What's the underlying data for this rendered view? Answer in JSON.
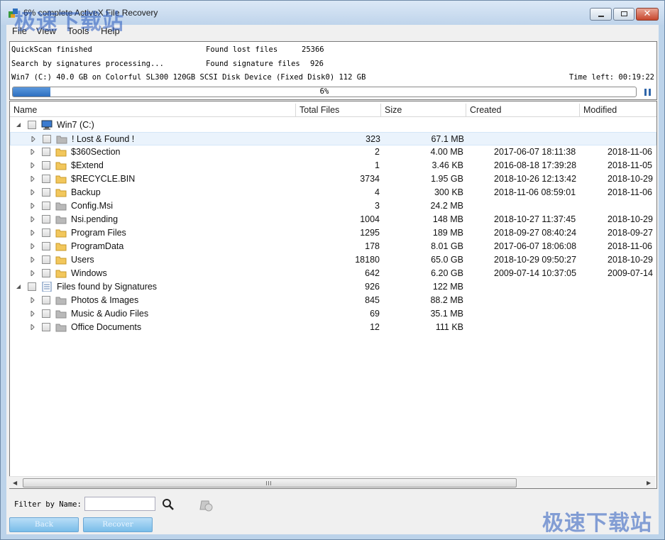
{
  "window": {
    "title": "6% complete ActiveX File Recovery",
    "controls": {
      "close_glyph": "✕"
    }
  },
  "menu": [
    "File",
    "View",
    "Tools",
    "Help"
  ],
  "watermarks": [
    "极速下载站",
    "极速下载站"
  ],
  "status": {
    "line1_left": "QuickScan finished",
    "line1_label": "Found lost files",
    "line1_value": "25366",
    "line2_left": "Search by signatures processing...",
    "line2_label": "Found signature files",
    "line2_value": "926",
    "line3_left": "Win7 (C:) 40.0 GB on Colorful SL300 120GB SCSI Disk Device (Fixed Disk0) 112 GB",
    "time_left": "Time left: 00:19:22",
    "progress_percent": 6,
    "progress_label": "6%"
  },
  "columns": [
    "Name",
    "Total Files",
    "Size",
    "Created",
    "Modified"
  ],
  "rows": [
    {
      "level": 0,
      "expanded": true,
      "icon": "drive-icon",
      "name": "Win7 (C:)",
      "files": "",
      "size": "",
      "created": "",
      "modified": ""
    },
    {
      "level": 1,
      "expanded": false,
      "icon": "gray-folder-icon",
      "name": "! Lost & Found !",
      "files": "323",
      "size": "67.1 MB",
      "created": "",
      "modified": "",
      "highlight": true
    },
    {
      "level": 1,
      "expanded": false,
      "icon": "folder-icon",
      "name": "$360Section",
      "files": "2",
      "size": "4.00 MB",
      "created": "2017-06-07 18:11:38",
      "modified": "2018-11-06"
    },
    {
      "level": 1,
      "expanded": false,
      "icon": "folder-icon",
      "name": "$Extend",
      "files": "1",
      "size": "3.46 KB",
      "created": "2016-08-18 17:39:28",
      "modified": "2018-11-05"
    },
    {
      "level": 1,
      "expanded": false,
      "icon": "folder-icon",
      "name": "$RECYCLE.BIN",
      "files": "3734",
      "size": "1.95 GB",
      "created": "2018-10-26 12:13:42",
      "modified": "2018-10-29"
    },
    {
      "level": 1,
      "expanded": false,
      "icon": "folder-icon",
      "name": "Backup",
      "files": "4",
      "size": "300 KB",
      "created": "2018-11-06 08:59:01",
      "modified": "2018-11-06"
    },
    {
      "level": 1,
      "expanded": false,
      "icon": "gray-folder-icon",
      "name": "Config.Msi",
      "files": "3",
      "size": "24.2 MB",
      "created": "",
      "modified": ""
    },
    {
      "level": 1,
      "expanded": false,
      "icon": "gray-folder-icon",
      "name": "Nsi.pending",
      "files": "1004",
      "size": "148 MB",
      "created": "2018-10-27 11:37:45",
      "modified": "2018-10-29"
    },
    {
      "level": 1,
      "expanded": false,
      "icon": "folder-icon",
      "name": "Program Files",
      "files": "1295",
      "size": "189 MB",
      "created": "2018-09-27 08:40:24",
      "modified": "2018-09-27"
    },
    {
      "level": 1,
      "expanded": false,
      "icon": "folder-icon",
      "name": "ProgramData",
      "files": "178",
      "size": "8.01 GB",
      "created": "2017-06-07 18:06:08",
      "modified": "2018-11-06"
    },
    {
      "level": 1,
      "expanded": false,
      "icon": "folder-icon",
      "name": "Users",
      "files": "18180",
      "size": "65.0 GB",
      "created": "2018-10-29 09:50:27",
      "modified": "2018-10-29"
    },
    {
      "level": 1,
      "expanded": false,
      "icon": "folder-icon",
      "name": "Windows",
      "files": "642",
      "size": "6.20 GB",
      "created": "2009-07-14 10:37:05",
      "modified": "2009-07-14"
    },
    {
      "level": 0,
      "expanded": true,
      "icon": "signature-list-icon",
      "name": "Files found by Signatures",
      "files": "926",
      "size": "122 MB",
      "created": "",
      "modified": ""
    },
    {
      "level": 1,
      "expanded": false,
      "icon": "gray-folder-icon",
      "name": "Photos & Images",
      "files": "845",
      "size": "88.2 MB",
      "created": "",
      "modified": ""
    },
    {
      "level": 1,
      "expanded": false,
      "icon": "gray-folder-icon",
      "name": "Music & Audio Files",
      "files": "69",
      "size": "35.1 MB",
      "created": "",
      "modified": ""
    },
    {
      "level": 1,
      "expanded": false,
      "icon": "gray-folder-icon",
      "name": "Office Documents",
      "files": "12",
      "size": "111 KB",
      "created": "",
      "modified": ""
    }
  ],
  "filter": {
    "label": "Filter by Name:",
    "value": ""
  },
  "buttons": {
    "back": "Back",
    "recover": "Recover"
  },
  "colors": {
    "accent": "#2d6fbf",
    "folder": "#f2c75c",
    "gray_folder": "#b9b9b9",
    "button": "#79bde9"
  }
}
